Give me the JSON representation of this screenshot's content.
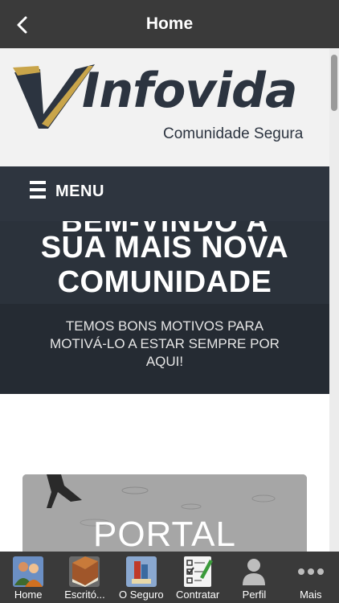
{
  "header": {
    "title": "Home",
    "back_icon": "chevron-left-icon"
  },
  "logo": {
    "brand": "Infovida",
    "tagline": "Comunidade Segura"
  },
  "menu": {
    "label": "MENU",
    "icon": "hamburger-icon"
  },
  "hero": {
    "clipped_line": "BEM-VINDO A",
    "title_line1": "SUA MAIS NOVA",
    "title_line2": "COMUNIDADE",
    "text_line1": "TEMOS BONS MOTIVOS PARA",
    "text_line2": "MOTIVÁ-LO A ESTAR SEMPRE POR",
    "text_line3": "AQUI!"
  },
  "portal": {
    "label": "PORTAL"
  },
  "tabs": [
    {
      "label": "Home",
      "icon": "people-icon"
    },
    {
      "label": "Escritó...",
      "icon": "book-icon"
    },
    {
      "label": "O Seguro",
      "icon": "books-icon"
    },
    {
      "label": "Contratar",
      "icon": "checklist-icon"
    },
    {
      "label": "Perfil",
      "icon": "person-icon"
    },
    {
      "label": "Mais",
      "icon": "more-dots-icon"
    }
  ],
  "colors": {
    "topbar": "#3a3a3a",
    "hero": "#2b323b",
    "logo_dark": "#2c3440",
    "logo_gold": "#c9a54a"
  }
}
